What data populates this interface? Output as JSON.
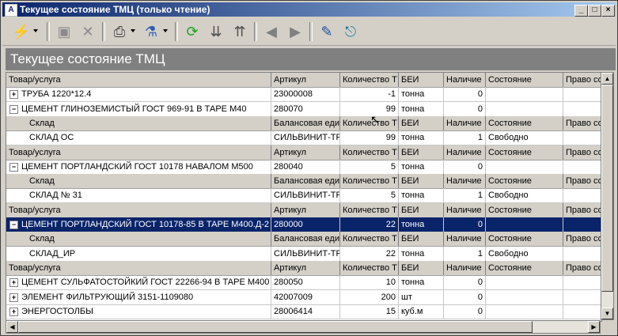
{
  "window": {
    "title": "Текущее состояние ТМЦ (только чтение)"
  },
  "header": {
    "title": "Текущее состояние ТМЦ"
  },
  "toolbar": {
    "icons": [
      "lightning-icon",
      "save-icon",
      "delete-icon",
      "print-icon",
      "filter-icon",
      "refresh-icon",
      "expand-all-icon",
      "collapse-all-icon",
      "back-icon",
      "forward-icon",
      "edit-icon",
      "exit-icon"
    ]
  },
  "columns": {
    "goods": [
      "Товар/услуга",
      "Артикул",
      "Количество Т",
      "БЕИ",
      "Наличие",
      "Состояние",
      "Право со"
    ],
    "stock": [
      "Склад",
      "Балансовая еди",
      "Количество Т",
      "БЕИ",
      "Наличие",
      "Состояние",
      "Право со"
    ]
  },
  "rows": [
    {
      "kind": "item",
      "exp": "+",
      "name": "ТРУБА 1220*12.4",
      "article": "23000008",
      "qty": "-1",
      "unit": "тонна",
      "avail": "0",
      "state": "",
      "right": ""
    },
    {
      "kind": "item",
      "exp": "−",
      "name": "ЦЕМЕНТ ГЛИНОЗЕМИСТЫЙ ГОСТ 969-91 В ТАРЕ М40",
      "article": "280070",
      "qty": "99",
      "unit": "тонна",
      "avail": "0",
      "state": "",
      "right": ""
    },
    {
      "kind": "subhead"
    },
    {
      "kind": "sub",
      "name": "СКЛАД ОС",
      "article": "СИЛЬВИНИТ-ТР",
      "qty": "99",
      "unit": "тонна",
      "avail": "1",
      "state": "Свободно",
      "right": ""
    },
    {
      "kind": "head"
    },
    {
      "kind": "item",
      "exp": "−",
      "name": "ЦЕМЕНТ ПОРТЛАНДСКИЙ ГОСТ 10178 НАВАЛОМ М500",
      "article": "280040",
      "qty": "5",
      "unit": "тонна",
      "avail": "0",
      "state": "",
      "right": ""
    },
    {
      "kind": "subhead"
    },
    {
      "kind": "sub",
      "name": "СКЛАД № 31",
      "article": "СИЛЬВИНИТ-ТР",
      "qty": "5",
      "unit": "тонна",
      "avail": "1",
      "state": "Свободно",
      "right": ""
    },
    {
      "kind": "head"
    },
    {
      "kind": "item",
      "sel": true,
      "exp": "−",
      "name": "ЦЕМЕНТ ПОРТЛАНДСКИЙ ГОСТ 10178-85 В ТАРЕ М400.Д-2",
      "article": "280000",
      "qty": "22",
      "unit": "тонна",
      "avail": "0",
      "state": "",
      "right": ""
    },
    {
      "kind": "subhead"
    },
    {
      "kind": "sub",
      "name": "СКЛАД_ИР",
      "article": "СИЛЬВИНИТ-ТР",
      "qty": "22",
      "unit": "тонна",
      "avail": "1",
      "state": "Свободно",
      "right": ""
    },
    {
      "kind": "head"
    },
    {
      "kind": "item",
      "exp": "+",
      "name": "ЦЕМЕНТ СУЛЬФАТОСТОЙКИЙ ГОСТ 22266-94 В ТАРЕ М400",
      "article": "280050",
      "qty": "10",
      "unit": "тонна",
      "avail": "0",
      "state": "",
      "right": ""
    },
    {
      "kind": "item",
      "exp": "+",
      "name": "ЭЛЕМЕНТ ФИЛЬТРУЮЩИЙ 3151-1109080",
      "article": "42007009",
      "qty": "200",
      "unit": "шт",
      "avail": "0",
      "state": "",
      "right": ""
    },
    {
      "kind": "item",
      "exp": "+",
      "name": "ЭНЕРГОСТОЛБЫ",
      "article": "28006414",
      "qty": "15",
      "unit": "куб.м",
      "avail": "0",
      "state": "",
      "right": ""
    }
  ]
}
